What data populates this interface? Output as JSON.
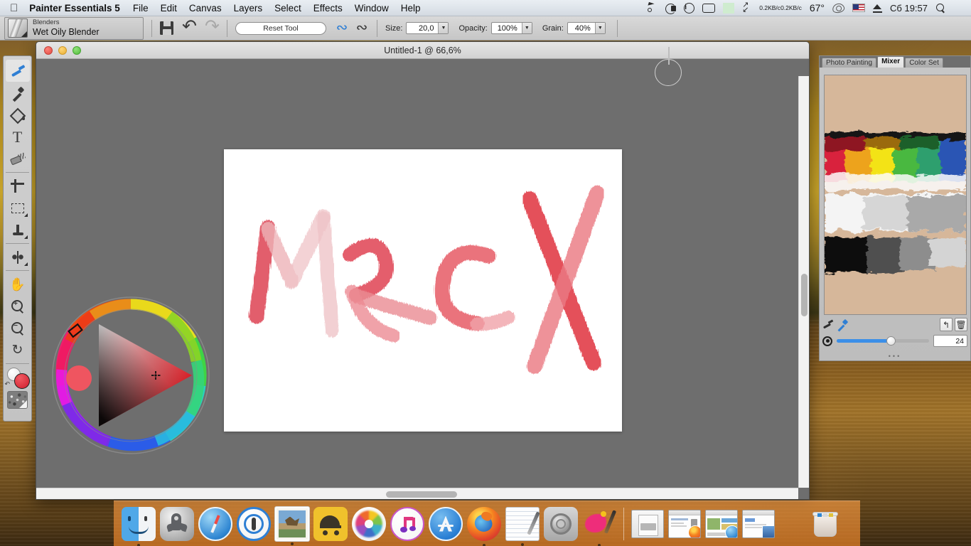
{
  "menubar": {
    "apple_logo": "",
    "app_name": "Painter Essentials 5",
    "menus": [
      "File",
      "Edit",
      "Canvas",
      "Layers",
      "Select",
      "Effects",
      "Window",
      "Help"
    ],
    "status": {
      "cursor_icon": "cursor-icon",
      "lock_icon": "lock-icon",
      "info_icon": "info-icon",
      "display_icon": "display-icon",
      "network_icon": "network-activity-icon",
      "expand_icon": "expand-arrows-icon",
      "net_up": "0.2KB/c",
      "net_down": "0.2KB/c",
      "temperature": "67°",
      "eye_icon": "eye-icon",
      "flag_icon": "us-flag-icon",
      "eject_icon": "eject-icon",
      "clock": "Сб 19:57",
      "search_icon": "search-icon",
      "list_icon": "notification-list-icon"
    }
  },
  "toolbar": {
    "brush_category": "Blenders",
    "brush_name": "Wet Oily Blender",
    "save_icon": "save-icon",
    "undo_icon": "undo-icon",
    "redo_icon": "redo-icon",
    "reset_tool_label": "Reset Tool",
    "stroke_icon_1": "record-stroke-icon",
    "stroke_icon_2": "playback-stroke-icon",
    "size_label": "Size:",
    "size_value": "20,0",
    "opacity_label": "Opacity:",
    "opacity_value": "100%",
    "grain_label": "Grain:",
    "grain_value": "40%"
  },
  "toolbox": {
    "tools": [
      {
        "name": "brush-tool",
        "selected": true
      },
      {
        "name": "dropper-tool",
        "selected": false
      },
      {
        "name": "paint-bucket-tool",
        "selected": false
      },
      {
        "name": "text-tool",
        "label": "T",
        "selected": false
      },
      {
        "name": "eraser-tool",
        "selected": false
      },
      {
        "name": "crop-tool",
        "selected": false
      },
      {
        "name": "rectangular-selection-tool",
        "selected": false
      },
      {
        "name": "cloner-tool",
        "selected": false
      },
      {
        "name": "mirror-painting-tool",
        "selected": false
      },
      {
        "name": "grabber-hand-tool",
        "selected": false
      },
      {
        "name": "magnifier-zoom-in-tool",
        "label": "+",
        "selected": false
      },
      {
        "name": "magnifier-zoom-out-tool",
        "label": "−",
        "selected": false
      },
      {
        "name": "rotate-page-tool",
        "selected": false
      }
    ],
    "primary_color": "#d9333f",
    "secondary_color": "#ffffff",
    "pattern_swatch": "pattern-swatch"
  },
  "document": {
    "title": "Untitled-1 @ 66,6%",
    "artwork_text": "Mac X",
    "paper_color": "#ffffff",
    "brush_cursor": "brush-cursor-ring"
  },
  "color_wheel": {
    "hue_marker_color": "#ee2b1c",
    "preview_color": "#ef5560",
    "selected_color": "#d9333f"
  },
  "right_panel": {
    "tabs": [
      {
        "label": "Photo Painting",
        "active": false
      },
      {
        "label": "Mixer",
        "active": true
      },
      {
        "label": "Color Set",
        "active": false
      }
    ],
    "mixer_bg": "#d6b79a",
    "controls": {
      "mixer_brush_icon": "mixer-brush-icon",
      "mixer_dropper_icon": "mixer-dropper-icon",
      "clear_icon": "reset-icon",
      "trash_icon": "trash-icon",
      "target_icon": "mixer-size-target-icon",
      "size_value": "24"
    }
  },
  "dock": {
    "items": [
      {
        "name": "finder",
        "running": true
      },
      {
        "name": "launchpad",
        "running": false
      },
      {
        "name": "safari",
        "running": true
      },
      {
        "name": "1password",
        "running": false
      },
      {
        "name": "mail",
        "running": true
      },
      {
        "name": "transmission",
        "running": false
      },
      {
        "name": "photos",
        "running": false
      },
      {
        "name": "itunes",
        "running": false
      },
      {
        "name": "app-store",
        "running": false
      },
      {
        "name": "firefox",
        "running": true
      },
      {
        "name": "textedit",
        "running": true
      },
      {
        "name": "system-preferences",
        "running": false
      },
      {
        "name": "painter-essentials",
        "running": true
      }
    ],
    "minimized": [
      "document-window",
      "firefox-window",
      "safari-window",
      "textedit-window"
    ],
    "trash": "trash-icon"
  }
}
